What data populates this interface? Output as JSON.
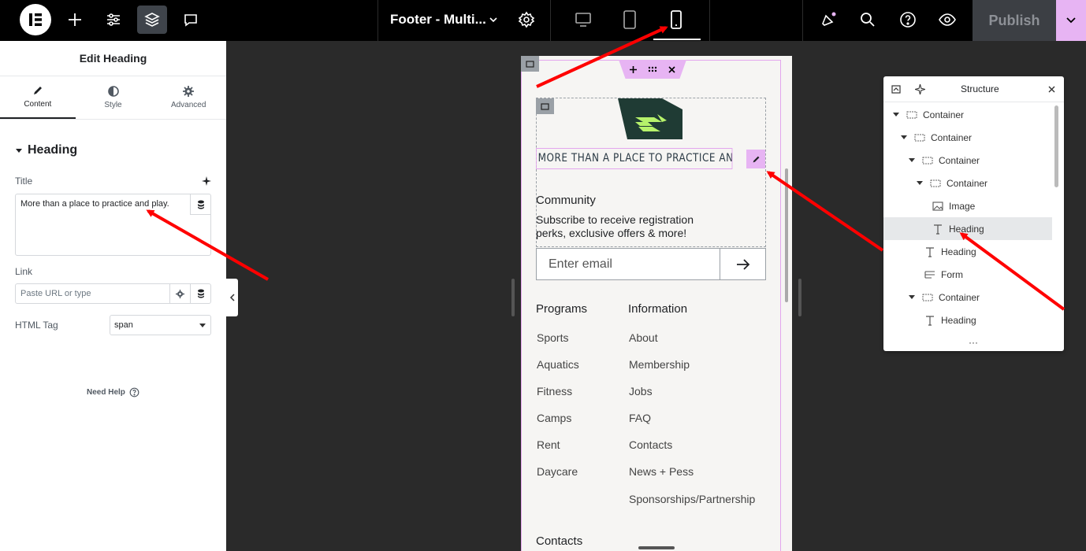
{
  "topbar": {
    "doc_title": "Footer - Multi...",
    "publish_label": "Publish",
    "icons": [
      "elementor-logo-icon",
      "add-icon",
      "settings-sliders-icon",
      "layers-icon",
      "comments-icon",
      "chevron-down-icon",
      "gear-icon",
      "desktop-icon",
      "tablet-icon",
      "mobile-icon",
      "announcements-icon",
      "search-icon",
      "help-icon",
      "preview-eye-icon"
    ],
    "accent": "#e7b4f3"
  },
  "panel": {
    "title": "Edit Heading",
    "tabs": [
      {
        "label": "Content",
        "icon": "pencil-icon"
      },
      {
        "label": "Style",
        "icon": "half-circle-icon"
      },
      {
        "label": "Advanced",
        "icon": "gear-icon"
      }
    ],
    "section": "Heading",
    "title_label": "Title",
    "title_value": "More than a place to practice and play.",
    "link_label": "Link",
    "link_placeholder": "Paste URL or type",
    "html_tag_label": "HTML Tag",
    "html_tag_value": "span",
    "need_help": "Need Help"
  },
  "preview": {
    "heading_text": "MORE THAN A PLACE TO PRACTICE AND PLAY.",
    "community": "Community",
    "subscribe": "Subscribe to receive registration perks, exclusive offers & more!",
    "email_placeholder": "Enter email",
    "programs_title": "Programs",
    "programs": [
      "Sports",
      "Aquatics",
      "Fitness",
      "Camps",
      "Rent",
      "Daycare"
    ],
    "information_title": "Information",
    "information": [
      "About",
      "Membership",
      "Jobs",
      "FAQ",
      "Contacts",
      "News + Pess",
      "Sponsorships/Partnership"
    ],
    "contacts_peek": "Contacts",
    "logo_colors": {
      "dark": "#1f3b34",
      "light": "#b6f26b"
    }
  },
  "structure": {
    "title": "Structure",
    "items": [
      {
        "label": "Container",
        "type": "container",
        "expanded": true
      },
      {
        "label": "Container",
        "type": "container",
        "expanded": true
      },
      {
        "label": "Container",
        "type": "container",
        "expanded": true
      },
      {
        "label": "Container",
        "type": "container",
        "expanded": true
      },
      {
        "label": "Image",
        "type": "image"
      },
      {
        "label": "Heading",
        "type": "heading",
        "selected": true
      },
      {
        "label": "Heading",
        "type": "heading"
      },
      {
        "label": "Form",
        "type": "form"
      },
      {
        "label": "Container",
        "type": "container",
        "expanded": true
      },
      {
        "label": "Heading",
        "type": "heading"
      }
    ]
  }
}
